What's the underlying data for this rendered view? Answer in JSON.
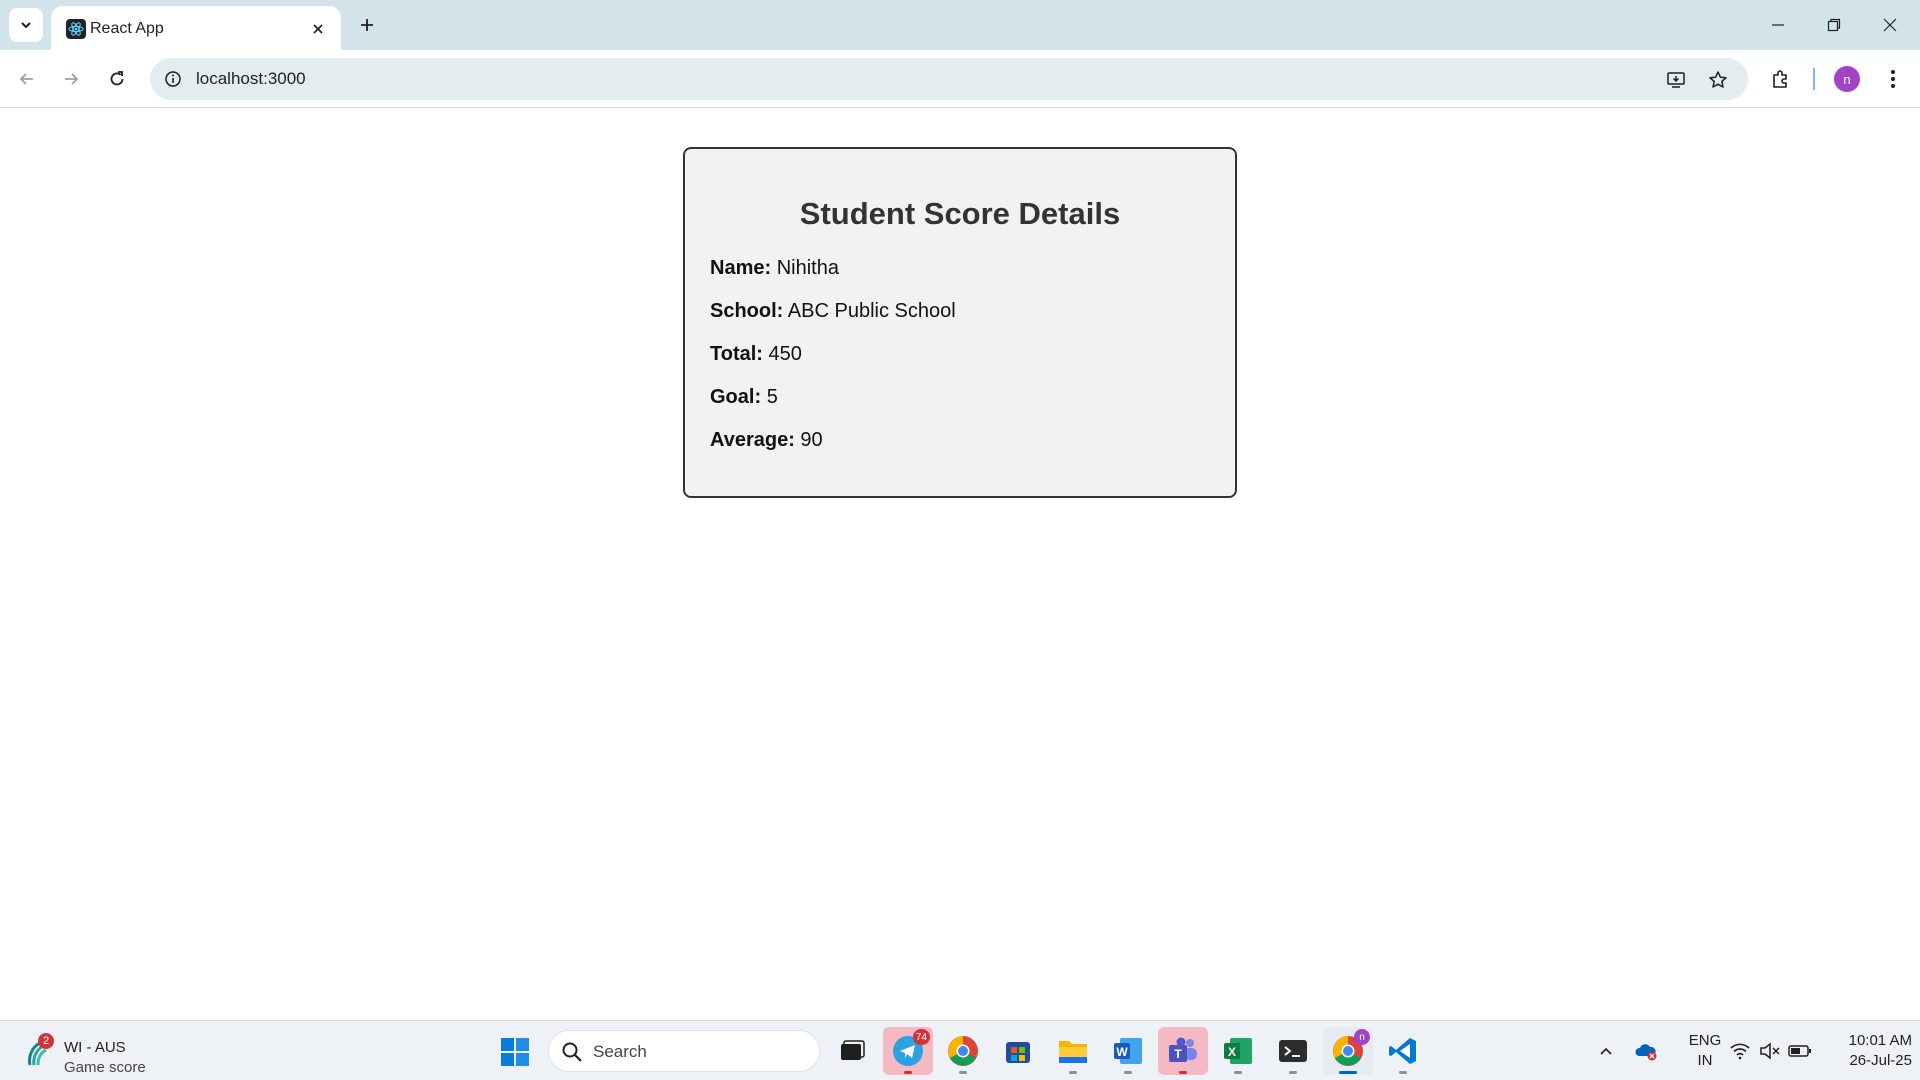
{
  "browser": {
    "tab_title": "React App",
    "url": "localhost:3000",
    "profile_initial": "n"
  },
  "card": {
    "title": "Student Score Details",
    "rows": [
      {
        "label": "Name:",
        "value": "Nihitha"
      },
      {
        "label": "School:",
        "value": "ABC Public School"
      },
      {
        "label": "Total:",
        "value": "450"
      },
      {
        "label": "Goal:",
        "value": "5"
      },
      {
        "label": "Average:",
        "value": "90"
      }
    ]
  },
  "taskbar": {
    "widget": {
      "title": "WI - AUS",
      "subtitle": "Game score",
      "badge": "2"
    },
    "search_label": "Search",
    "telegram_badge": "74",
    "chrome_profile_badge": "n",
    "language": {
      "line1": "ENG",
      "line2": "IN"
    },
    "clock": {
      "time": "10:01 AM",
      "date": "26-Jul-25"
    }
  },
  "colors": {
    "tabstrip": "#d3e3ea",
    "card_background": "#f2f2f2",
    "card_border": "#333333",
    "profile_avatar": "#a142c7"
  }
}
